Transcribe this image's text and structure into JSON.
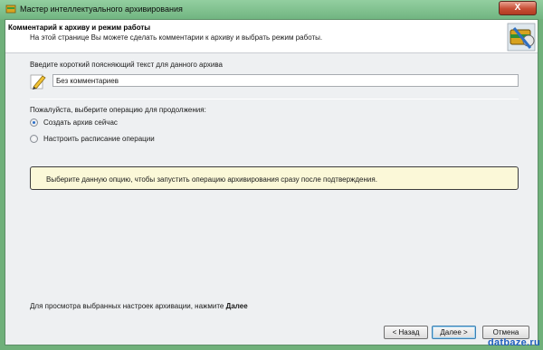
{
  "window": {
    "title": "Мастер интеллектуального архивирования",
    "close_symbol": "X"
  },
  "header": {
    "title": "Комментарий к архиву и режим работы",
    "description": "На этой странице Вы можете сделать комментарии к архиву и выбрать режим работы.",
    "icon": "archive-wizard-icon"
  },
  "comment": {
    "label": "Введите короткий поясняющий текст для данного архива",
    "value": "Без комментариев",
    "icon": "pencil-icon"
  },
  "operation": {
    "label": "Пожалуйста, выберите операцию для продолжения:",
    "options": [
      {
        "label": "Создать архив сейчас",
        "checked": true
      },
      {
        "label": "Настроить расписание операции",
        "checked": false
      }
    ]
  },
  "info": {
    "text": "Выберите данную опцию, чтобы запустить операцию архивирования сразу после подтверждения."
  },
  "footer": {
    "hint_prefix": "Для просмотра выбранных настроек архивации, нажмите",
    "hint_bold": "Далее"
  },
  "buttons": {
    "back": "< Назад",
    "next": "Далее >",
    "cancel": "Отмена"
  },
  "watermark": "datbaze.ru",
  "colors": {
    "frame": "#71b581",
    "client_bg": "#eef0f2",
    "info_bg": "#fbf8d8",
    "watermark": "#1f5fbf"
  }
}
